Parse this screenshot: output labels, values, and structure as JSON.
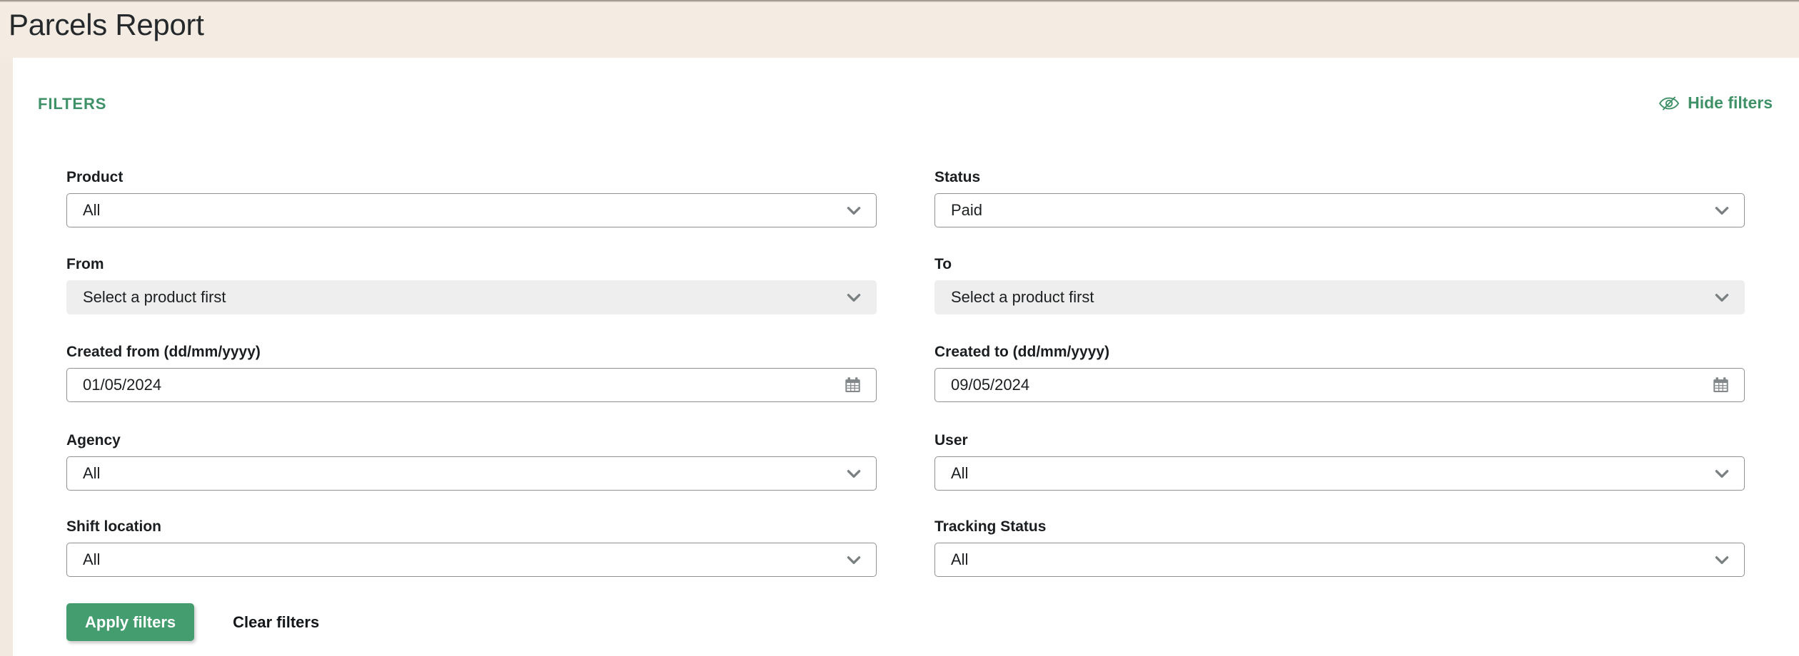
{
  "header": {
    "title": "Parcels Report"
  },
  "filters_panel": {
    "section_title": "FILTERS",
    "hide_filters_label": "Hide filters",
    "hide_filters_icon": "eye-slash-icon",
    "accent_color": "#3f9168",
    "apply_button_color": "#449d6e"
  },
  "fields": {
    "product": {
      "label": "Product",
      "value": "All",
      "type": "select",
      "icon": "chevron-down-icon",
      "disabled": false
    },
    "status": {
      "label": "Status",
      "value": "Paid",
      "type": "select",
      "icon": "chevron-down-icon",
      "disabled": false
    },
    "from": {
      "label": "From",
      "value": "Select a product first",
      "type": "select",
      "icon": "chevron-down-icon",
      "disabled": true
    },
    "to": {
      "label": "To",
      "value": "Select a product first",
      "type": "select",
      "icon": "chevron-down-icon",
      "disabled": true
    },
    "created_from": {
      "label": "Created from (dd/mm/yyyy)",
      "value": "01/05/2024",
      "type": "date",
      "icon": "calendar-icon",
      "disabled": false
    },
    "created_to": {
      "label": "Created to (dd/mm/yyyy)",
      "value": "09/05/2024",
      "type": "date",
      "icon": "calendar-icon",
      "disabled": false
    },
    "agency": {
      "label": "Agency",
      "value": "All",
      "type": "select",
      "icon": "chevron-down-icon",
      "disabled": false
    },
    "user": {
      "label": "User",
      "value": "All",
      "type": "select",
      "icon": "chevron-down-icon",
      "disabled": false
    },
    "shift_location": {
      "label": "Shift location",
      "value": "All",
      "type": "select",
      "icon": "chevron-down-icon",
      "disabled": false
    },
    "tracking_status": {
      "label": "Tracking Status",
      "value": "All",
      "type": "select",
      "icon": "chevron-down-icon",
      "disabled": false
    }
  },
  "actions": {
    "apply_label": "Apply filters",
    "clear_label": "Clear filters"
  }
}
